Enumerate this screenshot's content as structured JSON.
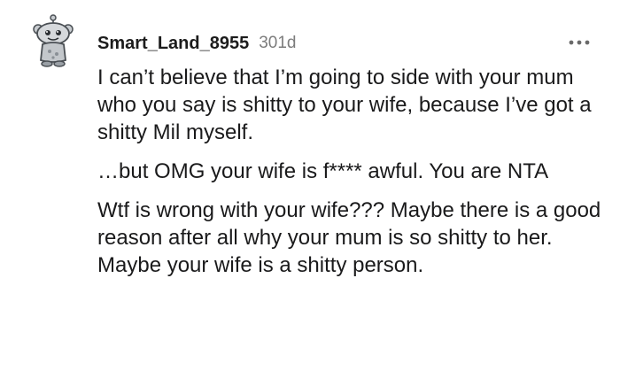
{
  "comment": {
    "username": "Smart_Land_8955",
    "age": "301d",
    "avatar_icon": "snoo-avatar-icon",
    "more_icon": "more-options-icon",
    "paragraphs": [
      "I can’t believe that I’m going to side with your mum who you say is shitty to your wife, because I’ve got a shitty Mil myself.",
      "…but OMG your wife is f**** awful. You are NTA",
      "Wtf is wrong with your wife??? Maybe there is a good reason after all why your mum is so shitty to her. Maybe your wife is a shitty person."
    ]
  }
}
